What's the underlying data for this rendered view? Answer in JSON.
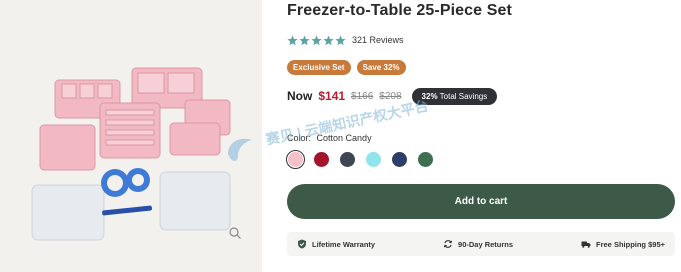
{
  "product": {
    "title": "Freezer-to-Table 25-Piece Set",
    "rating_value": 5,
    "reviews": "321 Reviews",
    "star_color": "#5aa3a0"
  },
  "badges": [
    "Exclusive Set",
    "Save 32%"
  ],
  "price": {
    "now_label": "Now",
    "now": "$141",
    "was_1": "$166",
    "was_2": "$208",
    "savings_pct": "32%",
    "savings_text": "Total Savings"
  },
  "color": {
    "label": "Color:",
    "selected": "Cotton Candy",
    "swatches": [
      {
        "name": "Cotton Candy",
        "hex": "#f4c1c9"
      },
      {
        "name": "Red",
        "hex": "#a3152a"
      },
      {
        "name": "Charcoal",
        "hex": "#3e4651"
      },
      {
        "name": "Aqua",
        "hex": "#8fe5ec"
      },
      {
        "name": "Navy",
        "hex": "#2c3f6b"
      },
      {
        "name": "Green",
        "hex": "#3f6f50"
      }
    ]
  },
  "cart": {
    "label": "Add to cart"
  },
  "perks": [
    {
      "icon": "shield-check-icon",
      "label": "Lifetime Warranty"
    },
    {
      "icon": "return-arrows-icon",
      "label": "90-Day Returns"
    },
    {
      "icon": "truck-icon",
      "label": "Free Shipping $95+"
    }
  ],
  "watermark": {
    "line1": "赛贝 | 云端知识产权大平台"
  },
  "colors": {
    "cart_button": "#3d5a48",
    "badge": "#c77a3a",
    "price_red": "#c0192e"
  }
}
